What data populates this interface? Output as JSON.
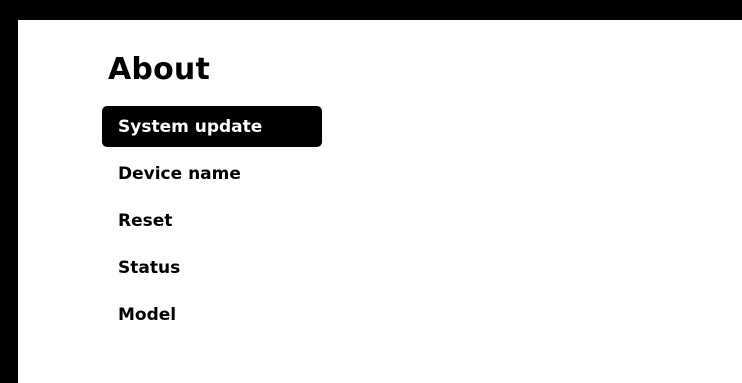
{
  "page": {
    "title": "About"
  },
  "menu": {
    "selected_index": 0,
    "items": [
      {
        "label": "System update"
      },
      {
        "label": "Device name"
      },
      {
        "label": "Reset"
      },
      {
        "label": "Status"
      },
      {
        "label": "Model"
      }
    ]
  },
  "colors": {
    "frame": "#000000",
    "background": "#ffffff",
    "text": "#000000",
    "selected_bg": "#000000",
    "selected_text": "#ffffff"
  }
}
